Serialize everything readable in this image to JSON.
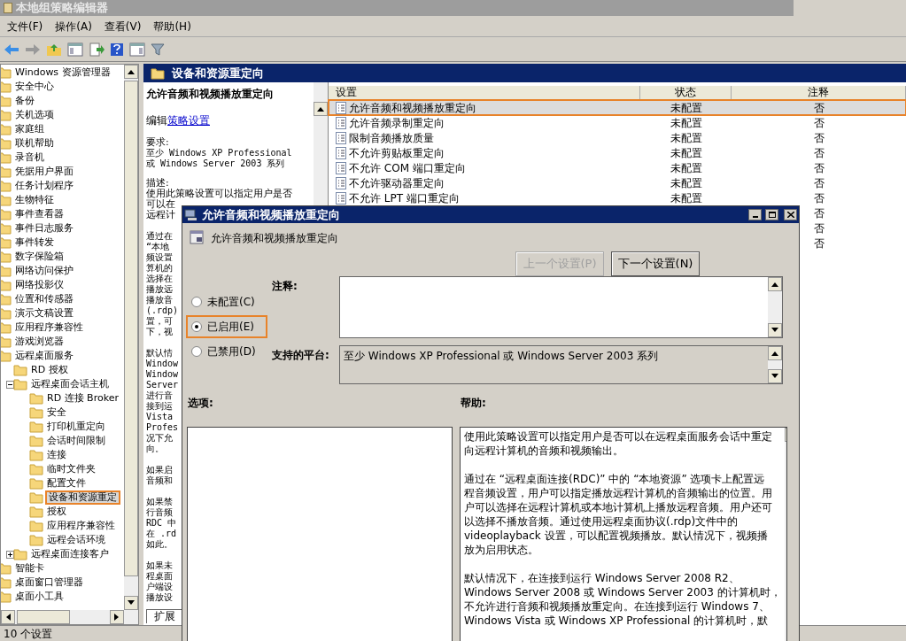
{
  "window": {
    "title": "本地组策略编辑器"
  },
  "menu": [
    "文件(F)",
    "操作(A)",
    "查看(V)",
    "帮助(H)"
  ],
  "tree": [
    {
      "label": "Windows 资源管理器"
    },
    {
      "label": "安全中心"
    },
    {
      "label": "备份"
    },
    {
      "label": "关机选项"
    },
    {
      "label": "家庭组"
    },
    {
      "label": "联机帮助"
    },
    {
      "label": "录音机"
    },
    {
      "label": "凭据用户界面"
    },
    {
      "label": "任务计划程序"
    },
    {
      "label": "生物特征"
    },
    {
      "label": "事件查看器"
    },
    {
      "label": "事件日志服务"
    },
    {
      "label": "事件转发"
    },
    {
      "label": "数字保险箱"
    },
    {
      "label": "网络访问保护"
    },
    {
      "label": "网络投影仪"
    },
    {
      "label": "位置和传感器"
    },
    {
      "label": "演示文稿设置"
    },
    {
      "label": "应用程序兼容性"
    },
    {
      "label": "游戏浏览器"
    },
    {
      "label": "远程桌面服务",
      "children": [
        {
          "label": "RD 授权"
        },
        {
          "label": "远程桌面会话主机",
          "expanded": true,
          "children": [
            {
              "label": "RD 连接 Broker"
            },
            {
              "label": "安全"
            },
            {
              "label": "打印机重定向"
            },
            {
              "label": "会话时间限制"
            },
            {
              "label": "连接"
            },
            {
              "label": "临时文件夹"
            },
            {
              "label": "配置文件"
            },
            {
              "label": "设备和资源重定",
              "selected": true,
              "highlighted": true
            },
            {
              "label": "授权"
            },
            {
              "label": "应用程序兼容性"
            },
            {
              "label": "远程会话环境"
            }
          ]
        },
        {
          "label": "远程桌面连接客户",
          "expanded": false
        }
      ]
    },
    {
      "label": "智能卡"
    },
    {
      "label": "桌面窗口管理器"
    },
    {
      "label": "桌面小工具"
    }
  ],
  "pane_header": "设备和资源重定向",
  "details": {
    "title": "允许音频和视频播放重定向",
    "edit_prefix": "编辑",
    "edit_link": "策略设置",
    "requirements_label": "要求:",
    "requirements": [
      "至少 Windows XP Professional",
      "或 Windows Server 2003 系列"
    ],
    "description_label": "描述:",
    "description_lines": [
      "使用此策略设置可以指定用户是否",
      "可以在",
      "远程计"
    ],
    "fragments": [
      [
        "通过在",
        "“本地",
        "频设置",
        "算机的",
        "选择在",
        "播放远",
        "播放音",
        "(.rdp)",
        "置，可",
        "下，视"
      ],
      [
        "默认情",
        "Window",
        "Window",
        "Server",
        "进行音",
        "接到运",
        "Vista",
        "Profes",
        "况下允",
        "向。"
      ],
      [
        "如果启",
        "音频和"
      ],
      [
        "如果禁",
        "行音频",
        "RDC 中",
        "在 .rd",
        "如此。"
      ],
      [
        "如果未",
        "程桌面",
        "户端设",
        "播放设"
      ]
    ],
    "tabs": [
      {
        "label": "扩展",
        "selected": true
      }
    ]
  },
  "table": {
    "columns": [
      "设置",
      "状态",
      "注释"
    ],
    "rows": [
      {
        "setting": "允许音频和视频播放重定向",
        "state": "未配置",
        "note": "否",
        "selected": true,
        "highlighted": true
      },
      {
        "setting": "允许音频录制重定向",
        "state": "未配置",
        "note": "否",
        "selected": false,
        "highlighted": false
      },
      {
        "setting": "限制音频播放质量",
        "state": "未配置",
        "note": "否",
        "selected": false,
        "highlighted": false
      },
      {
        "setting": "不允许剪贴板重定向",
        "state": "未配置",
        "note": "否",
        "selected": false,
        "highlighted": false
      },
      {
        "setting": "不允许 COM 端口重定向",
        "state": "未配置",
        "note": "否",
        "selected": false,
        "highlighted": false
      },
      {
        "setting": "不允许驱动器重定向",
        "state": "未配置",
        "note": "否",
        "selected": false,
        "highlighted": false
      },
      {
        "setting": "不允许 LPT 端口重定向",
        "state": "未配置",
        "note": "否",
        "selected": false,
        "highlighted": false
      },
      {
        "note": "否",
        "selected": false,
        "highlighted": false
      },
      {
        "note": "否",
        "selected": false,
        "highlighted": false
      },
      {
        "note": "否",
        "selected": false,
        "highlighted": false
      }
    ]
  },
  "status_bar": "10 个设置",
  "dialog": {
    "title": "允许音频和视频播放重定向",
    "setting_name": "允许音频和视频播放重定向",
    "buttons": [
      {
        "label": "上一个设置(P)",
        "disabled": true
      },
      {
        "label": "下一个设置(N)",
        "disabled": false
      }
    ],
    "options": [
      {
        "label": "未配置(C)",
        "selected": false,
        "highlighted": false
      },
      {
        "label": "已启用(E)",
        "selected": true,
        "highlighted": true
      },
      {
        "label": "已禁用(D)",
        "selected": false,
        "highlighted": false
      }
    ],
    "comment_label": "注释:",
    "platform_label": "支持的平台:",
    "platform": "至少 Windows XP Professional 或 Windows Server 2003 系列",
    "options_label": "选项:",
    "help_label": "帮助:",
    "help": [
      [
        "使用此策略设置可以指定用户是否可以在远程桌面服务会话中重定",
        "向远程计算机的音频和视频输出。"
      ],
      [
        "通过在 “远程桌面连接(RDC)” 中的 “本地资源” 选项卡上配置远",
        "程音频设置，用户可以指定播放远程计算机的音频输出的位置。用",
        "户可以选择在远程计算机或本地计算机上播放远程音频。用户还可",
        "以选择不播放音频。通过使用远程桌面协议(.rdp)文件中的",
        "videoplayback 设置，可以配置视频播放。默认情况下，视频播",
        "放为启用状态。"
      ],
      [
        "默认情况下，在连接到运行 Windows Server 2008 R2、",
        "Windows Server 2008 或 Windows Server 2003 的计算机时，",
        "不允许进行音频和视频播放重定向。在连接到运行 Windows 7、",
        "Windows Vista 或 Windows XP Professional 的计算机时，默"
      ]
    ]
  }
}
